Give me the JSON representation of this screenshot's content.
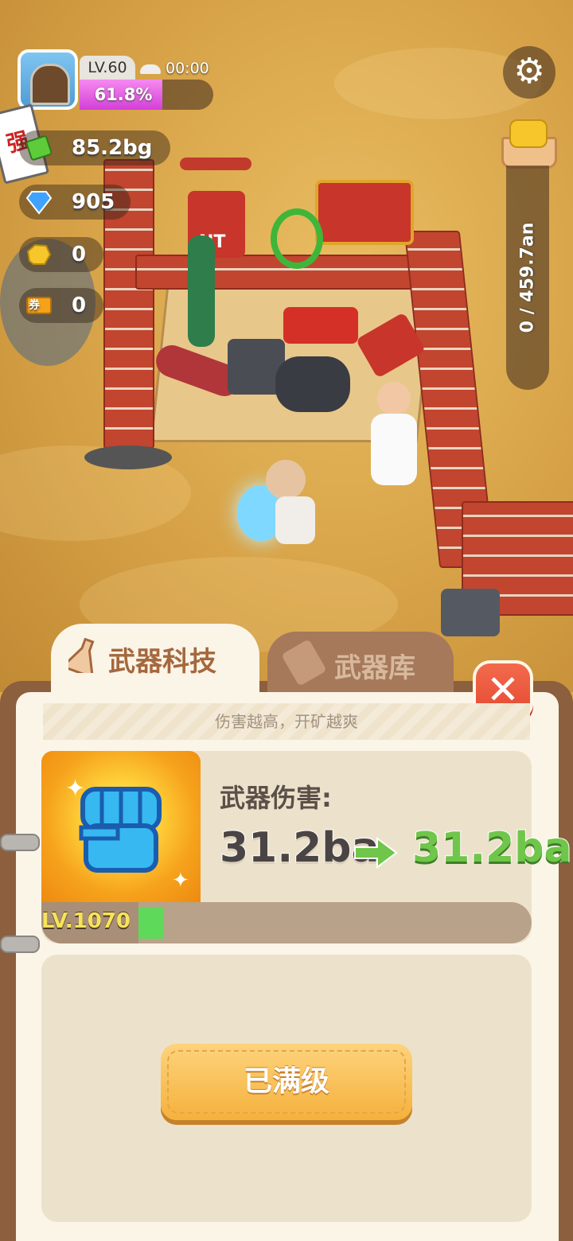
{
  "hud": {
    "level": "LV.60",
    "timer": "00:00",
    "xp_percent_text": "61.8%",
    "xp_fraction": 0.618,
    "sign_char": "强",
    "cash": "85.2bg",
    "gems": "905",
    "gold": "0",
    "tickets": "0",
    "ticket_badge": "券",
    "capacity": "0 / 459.7an"
  },
  "scene": {
    "tnt_label": "NT"
  },
  "tabs": {
    "active": "武器科技",
    "inactive": "武器库"
  },
  "panel": {
    "subtitle": "伤害越高，开矿越爽",
    "stat_label": "武器伤害:",
    "stat_old": "31.2ba",
    "stat_new": "31.2ba",
    "level_text": "LV.1070",
    "button_label": "已满级",
    "close_label": "✕"
  },
  "colors": {
    "xp": "#d43fd8",
    "upgrade_green": "#6fc64a",
    "close_red": "#e24a32",
    "button_gold": "#f5b13c"
  }
}
